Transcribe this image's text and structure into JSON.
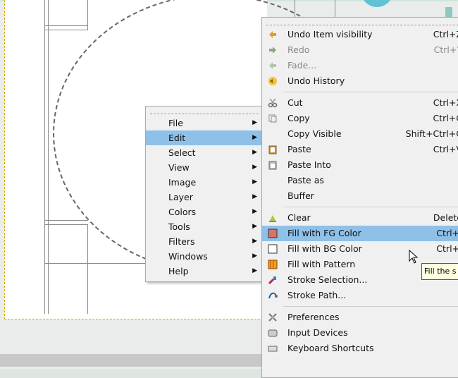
{
  "context_menu": {
    "items": [
      {
        "label": "File"
      },
      {
        "label": "Edit"
      },
      {
        "label": "Select"
      },
      {
        "label": "View"
      },
      {
        "label": "Image"
      },
      {
        "label": "Layer"
      },
      {
        "label": "Colors"
      },
      {
        "label": "Tools"
      },
      {
        "label": "Filters"
      },
      {
        "label": "Windows"
      },
      {
        "label": "Help"
      }
    ]
  },
  "edit_menu": {
    "undo": {
      "label": "Undo Item visibility",
      "shortcut": "Ctrl+Z"
    },
    "redo": {
      "label": "Redo",
      "shortcut": "Ctrl+Y"
    },
    "fade": {
      "label": "Fade..."
    },
    "undo_history": {
      "label": "Undo History"
    },
    "cut": {
      "label": "Cut",
      "shortcut": "Ctrl+X"
    },
    "copy": {
      "label": "Copy",
      "shortcut": "Ctrl+C"
    },
    "copy_visible": {
      "label": "Copy Visible",
      "shortcut": "Shift+Ctrl+C"
    },
    "paste": {
      "label": "Paste",
      "shortcut": "Ctrl+V"
    },
    "paste_into": {
      "label": "Paste Into"
    },
    "paste_as": {
      "label": "Paste as"
    },
    "buffer": {
      "label": "Buffer"
    },
    "clear": {
      "label": "Clear",
      "shortcut": "Delete"
    },
    "fill_fg": {
      "label": "Fill with FG Color",
      "shortcut": "Ctrl+,"
    },
    "fill_bg": {
      "label": "Fill with BG Color",
      "shortcut": "Ctrl+."
    },
    "fill_pattern": {
      "label": "Fill with Pattern"
    },
    "stroke_selection": {
      "label": "Stroke Selection..."
    },
    "stroke_path": {
      "label": "Stroke Path..."
    },
    "preferences": {
      "label": "Preferences"
    },
    "input_devices": {
      "label": "Input Devices"
    },
    "keyboard_shortcuts": {
      "label": "Keyboard Shortcuts"
    }
  },
  "tooltip": {
    "text": "Fill the s"
  },
  "colors": {
    "highlight": "#8fc0e8",
    "fg_fill": "#d9736a",
    "pattern": "#f0a020"
  }
}
